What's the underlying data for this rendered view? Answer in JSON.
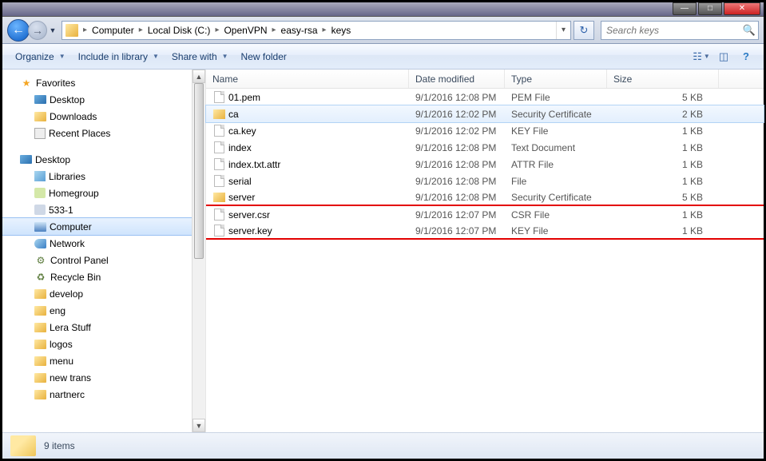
{
  "window_controls": {
    "min": "—",
    "max": "□",
    "close": "✕"
  },
  "nav": {
    "back": "←",
    "forward": "→",
    "dropdown": "▼"
  },
  "breadcrumb": [
    "Computer",
    "Local Disk (C:)",
    "OpenVPN",
    "easy-rsa",
    "keys"
  ],
  "breadcrumb_refresh": "↻",
  "search": {
    "placeholder": "Search keys"
  },
  "toolbar": {
    "organize": "Organize",
    "include": "Include in library",
    "share": "Share with",
    "newfolder": "New folder"
  },
  "columns": {
    "name": "Name",
    "date": "Date modified",
    "type": "Type",
    "size": "Size"
  },
  "tree": {
    "favorites": "Favorites",
    "desktop": "Desktop",
    "downloads": "Downloads",
    "recent": "Recent Places",
    "desktop2": "Desktop",
    "libraries": "Libraries",
    "homegroup": "Homegroup",
    "user533": "533-1",
    "computer": "Computer",
    "network": "Network",
    "cpanel": "Control Panel",
    "recycle": "Recycle Bin",
    "develop": "develop",
    "eng": "eng",
    "lera": "Lera Stuff",
    "logos": "logos",
    "menu": "menu",
    "newtrans": "new trans",
    "partners": "nartnerc"
  },
  "files": [
    {
      "name": "01.pem",
      "date": "9/1/2016 12:08 PM",
      "type": "PEM File",
      "size": "5 KB",
      "icon": "generic",
      "sel": false,
      "hl": false
    },
    {
      "name": "ca",
      "date": "9/1/2016 12:02 PM",
      "type": "Security Certificate",
      "size": "2 KB",
      "icon": "cert",
      "sel": true,
      "hl": false
    },
    {
      "name": "ca.key",
      "date": "9/1/2016 12:02 PM",
      "type": "KEY File",
      "size": "1 KB",
      "icon": "generic",
      "sel": false,
      "hl": false
    },
    {
      "name": "index",
      "date": "9/1/2016 12:08 PM",
      "type": "Text Document",
      "size": "1 KB",
      "icon": "generic",
      "sel": false,
      "hl": false
    },
    {
      "name": "index.txt.attr",
      "date": "9/1/2016 12:08 PM",
      "type": "ATTR File",
      "size": "1 KB",
      "icon": "generic",
      "sel": false,
      "hl": false
    },
    {
      "name": "serial",
      "date": "9/1/2016 12:08 PM",
      "type": "File",
      "size": "1 KB",
      "icon": "generic",
      "sel": false,
      "hl": false
    },
    {
      "name": "server",
      "date": "9/1/2016 12:08 PM",
      "type": "Security Certificate",
      "size": "5 KB",
      "icon": "cert",
      "sel": false,
      "hl": true
    },
    {
      "name": "server.csr",
      "date": "9/1/2016 12:07 PM",
      "type": "CSR File",
      "size": "1 KB",
      "icon": "generic",
      "sel": false,
      "hl": false
    },
    {
      "name": "server.key",
      "date": "9/1/2016 12:07 PM",
      "type": "KEY File",
      "size": "1 KB",
      "icon": "generic",
      "sel": false,
      "hl": true
    }
  ],
  "status": {
    "count": "9 items"
  }
}
